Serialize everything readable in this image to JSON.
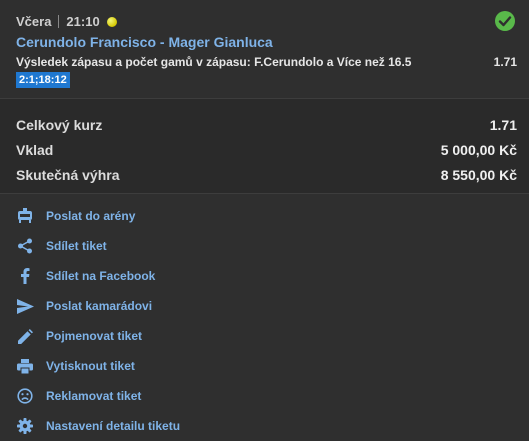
{
  "ticket": {
    "day": "Včera",
    "time": "21:10",
    "event_name": "Cerundolo Francisco - Mager Gianluca",
    "bet_description": "Výsledek zápasu a počet gamů v zápasu: F.Cerundolo a Více než 16.5",
    "bet_odds": "1.71",
    "score": "2:1;18:12",
    "status_icon": "check-circle-icon",
    "status_color": "#59b94a",
    "sport_icon": "tennis-ball-icon"
  },
  "summary": {
    "total_odds_label": "Celkový kurz",
    "total_odds_value": "1.71",
    "stake_label": "Vklad",
    "stake_value": "5 000,00 Kč",
    "payout_label": "Skutečná výhra",
    "payout_value": "8 550,00 Kč"
  },
  "actions": [
    {
      "label": "Poslat do arény",
      "icon": "arena-icon"
    },
    {
      "label": "Sdílet tiket",
      "icon": "share-icon"
    },
    {
      "label": "Sdílet na Facebook",
      "icon": "facebook-icon"
    },
    {
      "label": "Poslat kamarádovi",
      "icon": "send-icon"
    },
    {
      "label": "Pojmenovat tiket",
      "icon": "pencil-icon"
    },
    {
      "label": "Vytisknout tiket",
      "icon": "printer-icon"
    },
    {
      "label": "Reklamovat tiket",
      "icon": "sad-face-icon"
    },
    {
      "label": "Nastavení detailu tiketu",
      "icon": "gear-icon"
    }
  ],
  "colors": {
    "accent_link": "#7fb3e8",
    "score_badge": "#1f78d1",
    "background": "#2f2f2f"
  }
}
